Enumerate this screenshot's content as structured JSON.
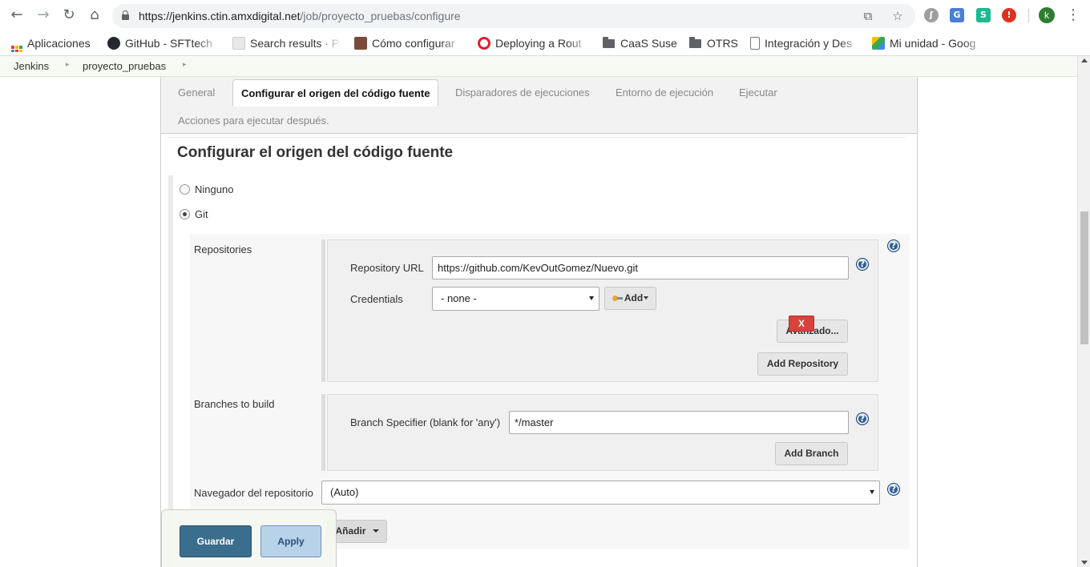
{
  "browser": {
    "url_host": "https://jenkins.ctin.amxdigital.net",
    "url_path": "/job/proyecto_pruebas/configure",
    "avatar_letter": "k"
  },
  "bookmarks": [
    {
      "label": "Aplicaciones",
      "icon": "apps-grid-icon"
    },
    {
      "label": "GitHub - SFTtech",
      "icon": "github-icon"
    },
    {
      "label": "Search results · P",
      "icon": "page-icon"
    },
    {
      "label": "Cómo configurar",
      "icon": "site-icon"
    },
    {
      "label": "Deploying a Rout",
      "icon": "openshift-icon"
    },
    {
      "label": "CaaS Suse",
      "icon": "folder-icon"
    },
    {
      "label": "OTRS",
      "icon": "folder-icon"
    },
    {
      "label": "Integración y Des",
      "icon": "document-icon"
    },
    {
      "label": "Mi unidad - Goog",
      "icon": "drive-icon"
    }
  ],
  "breadcrumb": [
    {
      "label": "Jenkins"
    },
    {
      "label": "proyecto_pruebas"
    }
  ],
  "tabs": [
    {
      "label": "General",
      "active": false
    },
    {
      "label": "Configurar el origen del código fuente",
      "active": true
    },
    {
      "label": "Disparadores de ejecuciones",
      "active": false
    },
    {
      "label": "Entorno de ejecución",
      "active": false
    },
    {
      "label": "Ejecutar",
      "active": false
    },
    {
      "label": "Acciones para ejecutar después.",
      "active": false
    }
  ],
  "section": {
    "title": "Configurar el origen del código fuente",
    "scm_options": [
      {
        "label": "Ninguno",
        "selected": false
      },
      {
        "label": "Git",
        "selected": true
      }
    ]
  },
  "repositories": {
    "label": "Repositories",
    "url_label": "Repository URL",
    "url_value": "https://github.com/KevOutGomez/Nuevo.git",
    "credentials_label": "Credentials",
    "credentials_value": "- none -",
    "add_label": "Add",
    "advanced_label": "Avanzado...",
    "add_repository_label": "Add Repository"
  },
  "branches": {
    "label": "Branches to build",
    "delete_label": "X",
    "specifier_label": "Branch Specifier (blank for 'any')",
    "specifier_value": "*/master",
    "add_branch_label": "Add Branch"
  },
  "browser_field": {
    "label": "Navegador del repositorio",
    "value": "(Auto)"
  },
  "additional": {
    "add_label": "Añadir"
  },
  "help_label": "?",
  "savebar": {
    "save_label": "Guardar",
    "apply_label": "Apply"
  },
  "colors": {
    "accent": "#3b6d8c",
    "danger": "#d9413c",
    "help": "#2f5f99"
  }
}
